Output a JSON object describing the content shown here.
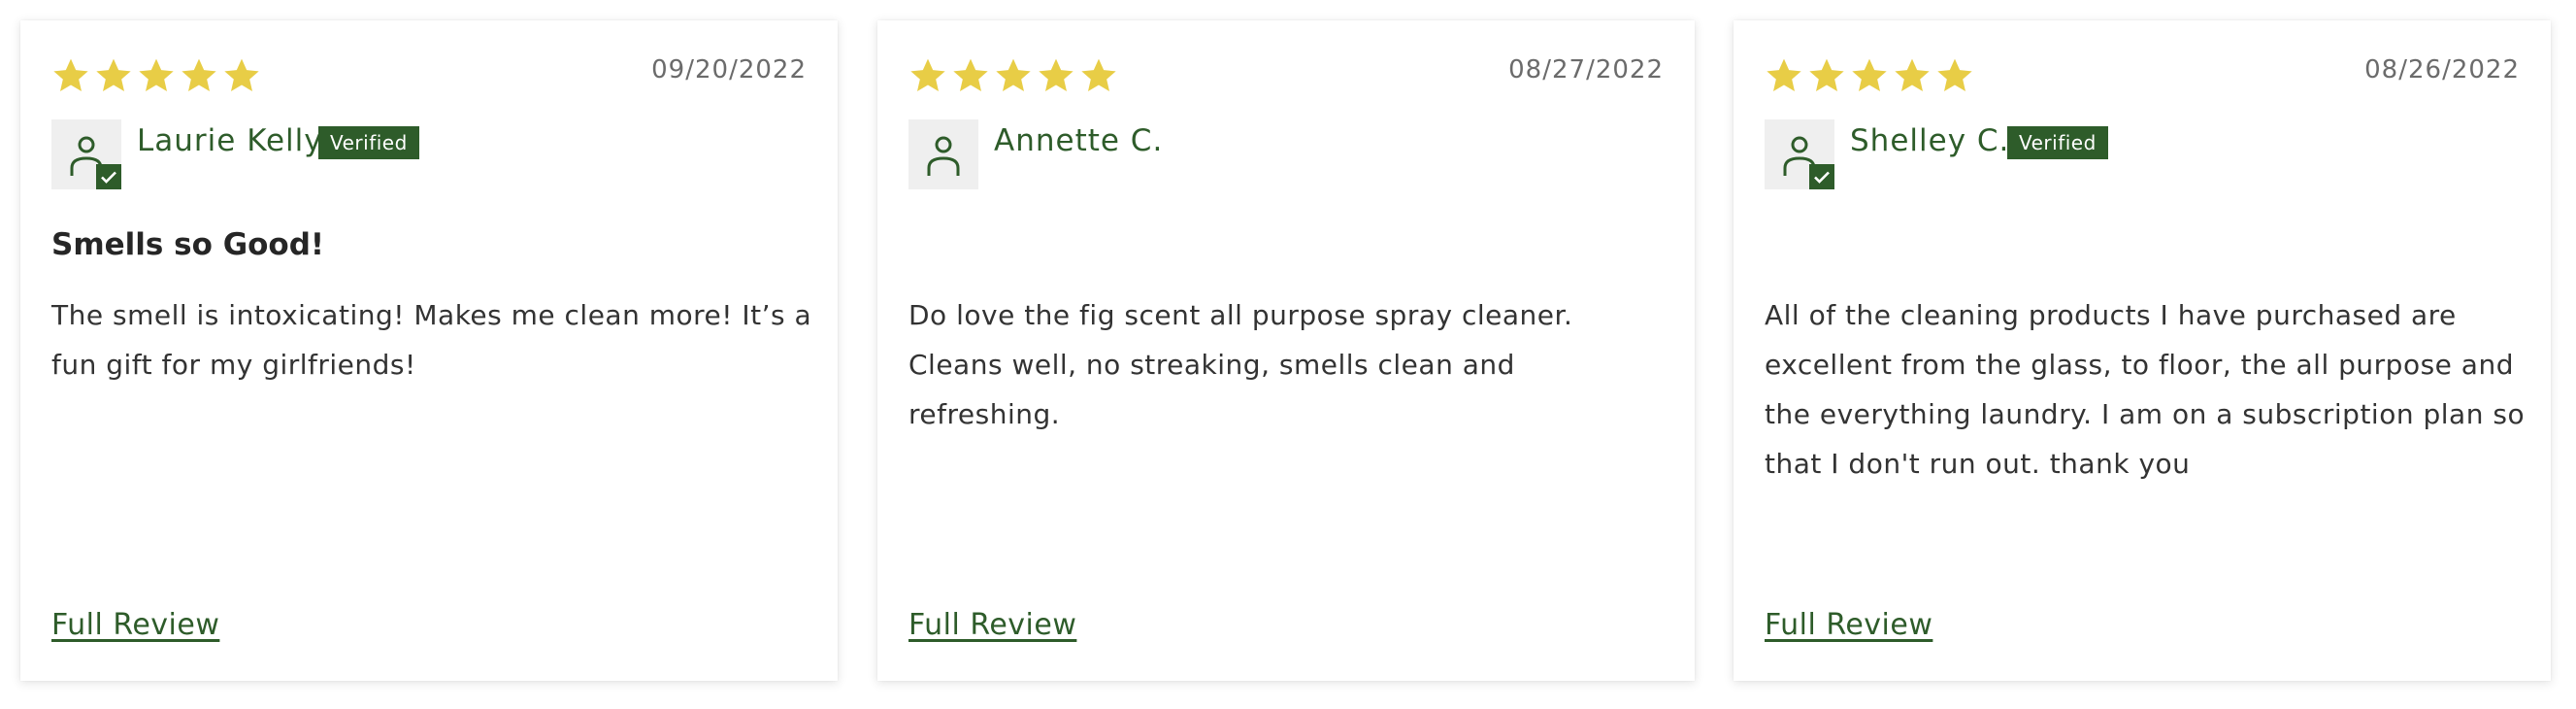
{
  "colors": {
    "accent": "#2e5c2a",
    "star": "#e8cd46",
    "avatar_bg": "#efefef"
  },
  "reviews": [
    {
      "rating": 5,
      "date": "09/20/2022",
      "author": "Laurie Kelly",
      "verified": true,
      "badge_label": "Verified",
      "title": "Smells so Good!",
      "body": "The smell is intoxicating! Makes me clean more! It’s a fun gift for my girlfriends!",
      "link_label": "Full Review"
    },
    {
      "rating": 5,
      "date": "08/27/2022",
      "author": "Annette C.",
      "verified": false,
      "badge_label": "",
      "title": "",
      "body": "Do love the fig scent all purpose spray cleaner. Cleans well, no streaking, smells clean and refreshing.",
      "link_label": "Full Review"
    },
    {
      "rating": 5,
      "date": "08/26/2022",
      "author": "Shelley C.",
      "verified": true,
      "badge_label": "Verified",
      "title": "",
      "body": "All of the cleaning products I have purchased are excellent from the glass, to floor, the all purpose and the everything laundry. I am on a subscription plan so that I don't run out. thank you",
      "link_label": "Full Review"
    }
  ]
}
